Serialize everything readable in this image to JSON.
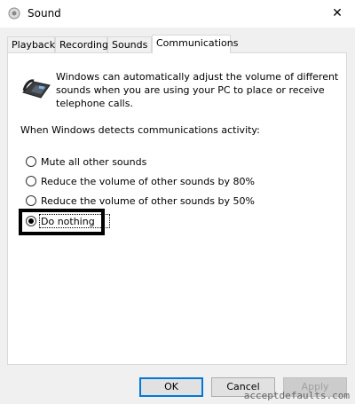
{
  "window": {
    "title": "Sound",
    "close_symbol": "✕"
  },
  "tabs": [
    {
      "label": "Playback",
      "active": false
    },
    {
      "label": "Recording",
      "active": false
    },
    {
      "label": "Sounds",
      "active": false
    },
    {
      "label": "Communications",
      "active": true
    }
  ],
  "communications": {
    "intro": "Windows can automatically adjust the volume of different sounds when you are using your PC to place or receive telephone calls.",
    "section_label": "When Windows detects communications activity:",
    "options": [
      {
        "label": "Mute all other sounds",
        "checked": false
      },
      {
        "label": "Reduce the volume of other sounds by 80%",
        "checked": false
      },
      {
        "label": "Reduce the volume of other sounds by 50%",
        "checked": false
      },
      {
        "label": "Do nothing",
        "checked": true
      }
    ]
  },
  "buttons": {
    "ok": "OK",
    "cancel": "Cancel",
    "apply": "Apply"
  },
  "watermark": "acceptdefaults.com"
}
